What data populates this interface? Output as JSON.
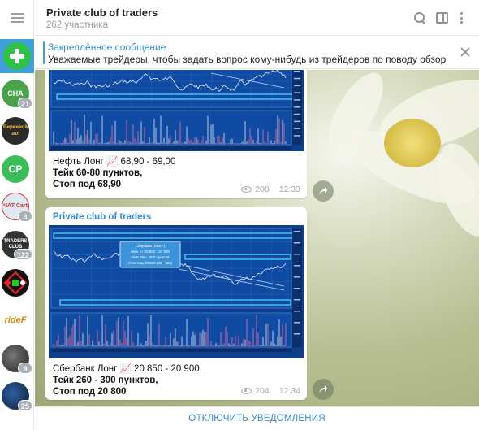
{
  "chat": {
    "title": "Private club of traders",
    "subtitle": "262 участника"
  },
  "pinned": {
    "title": "Закреплённое сообщение",
    "text": "Уважаемые трейдеры, чтобы задать вопрос кому-нибудь из трейдеров по поводу обзора инструмент..."
  },
  "sidebar": {
    "chats": [
      {
        "label": "СНА",
        "badge": "21",
        "color": "#4aa24a"
      },
      {
        "label": "Биржевой зал",
        "badge": "",
        "color": "#2a2a2a"
      },
      {
        "label": "CP",
        "badge": "",
        "color": "#3dbd5a"
      },
      {
        "label": "ЧАТ Cart",
        "badge": "3",
        "color": "#dfe9f2"
      },
      {
        "label": "TRADERS CLUB",
        "badge": "122",
        "color": "#333333"
      },
      {
        "label": "",
        "badge": "",
        "color": "#111111"
      },
      {
        "label": "rideF",
        "badge": "",
        "color": "#ffffff"
      },
      {
        "label": "",
        "badge": "9",
        "color": "#3b3b3b"
      },
      {
        "label": "",
        "badge": "25",
        "color": "#1c2f5a"
      }
    ]
  },
  "messages": [
    {
      "line1": "Нефть Лонг 📈 68,90 - 69,00",
      "line2": "Тейк 60-80 пунктов,",
      "line3": "Стоп под 68,90",
      "views": "208",
      "time": "12:33"
    },
    {
      "sender": "Private club of traders",
      "line1": "Сбербанк Лонг 📈 20 850 - 20 900",
      "line2": "Тейк 260 - 300 пунктов,",
      "line3": "Стоп под 20 800",
      "views": "204",
      "time": "12:34"
    }
  ],
  "chart2_callout": [
    "Сбербанк (SBRF)",
    "Лонг от 20 850 - 20 900",
    "Тейк 260 - 300 пунктов",
    "Стоп под 20 800 (40 - 60п)"
  ],
  "bottom": {
    "mute_label": "ОТКЛЮЧИТЬ УВЕДОМЛЕНИЯ"
  },
  "colors": {
    "accent": "#419fd9",
    "link": "#3a8dcb",
    "chart_bg": "#0d3f8c",
    "zone": "#4fe3ff"
  }
}
